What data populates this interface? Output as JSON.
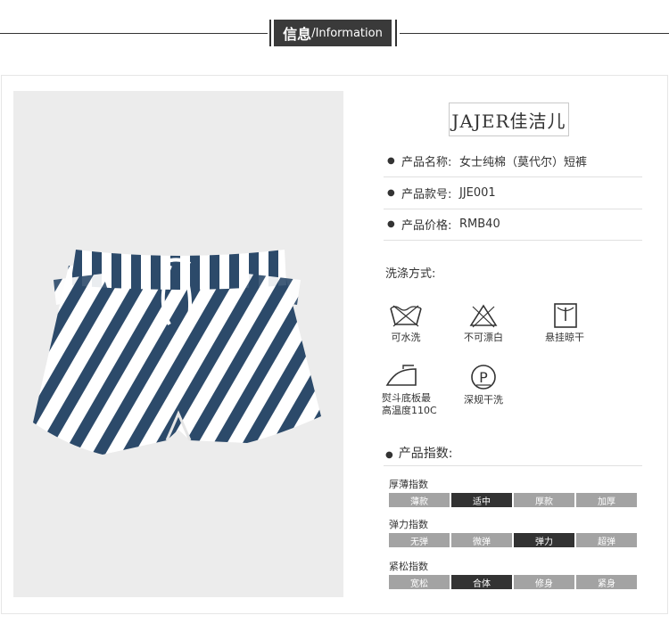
{
  "header": {
    "title_zh": "信息",
    "title_en": "/Information"
  },
  "brand": {
    "logo_text": "JAJER佳洁儿"
  },
  "product": {
    "rows": [
      {
        "label": "产品名称:",
        "value": "女士纯棉（莫代尔）短裤"
      },
      {
        "label": "产品款号:",
        "value": "JJE001"
      },
      {
        "label": "产品价格:",
        "value": "RMB40"
      }
    ]
  },
  "wash": {
    "title": "洗涤方式:",
    "icons": [
      {
        "name": "hand-wash-icon",
        "label": "可水洗"
      },
      {
        "name": "no-bleach-icon",
        "label": "不可漂白"
      },
      {
        "name": "hang-dry-icon",
        "label": "悬挂晾干"
      },
      {
        "name": "iron-icon",
        "label1": "熨斗底板最",
        "label2": "高温度110C"
      },
      {
        "name": "dry-clean-icon",
        "label": "深规干洗"
      }
    ]
  },
  "index": {
    "title": "产品指数:",
    "groups": [
      {
        "label": "厚薄指数",
        "options": [
          "薄款",
          "适中",
          "厚款",
          "加厚"
        ],
        "selected": 1
      },
      {
        "label": "弹力指数",
        "options": [
          "无弹",
          "微弹",
          "弹力",
          "超弹"
        ],
        "selected": 2
      },
      {
        "label": "紧松指数",
        "options": [
          "宽松",
          "合体",
          "修身",
          "紧身"
        ],
        "selected": 1
      }
    ]
  },
  "colors": {
    "stripe": "#2c4a6a",
    "selected": "#333333",
    "unselected": "#a3a3a3"
  }
}
